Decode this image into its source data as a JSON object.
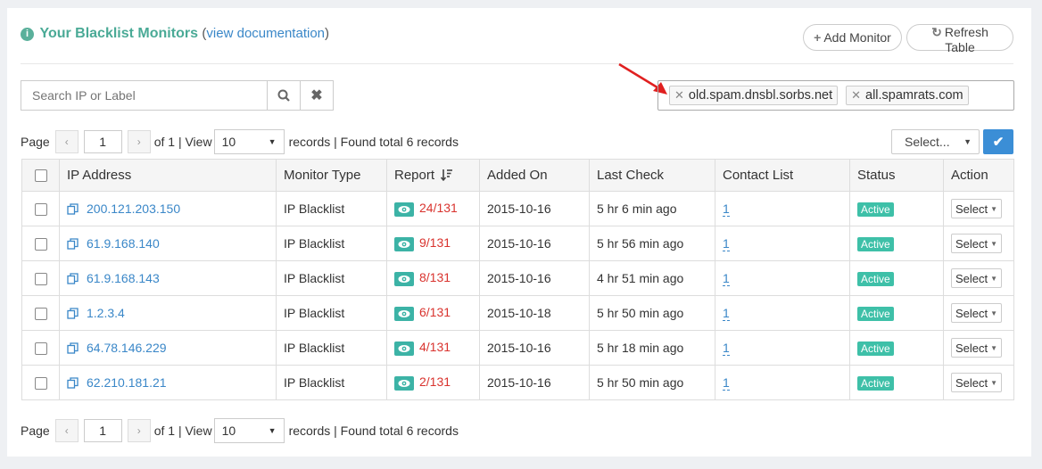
{
  "header": {
    "info_icon": "info-circle-icon",
    "title": "Your Blacklist Monitors",
    "doc_open": "(",
    "doc_link": "view documentation",
    "doc_close": ")"
  },
  "toolbar": {
    "add_label": "Add Monitor",
    "refresh_label": "Refresh Table"
  },
  "search": {
    "placeholder": "Search IP or Label",
    "search_icon": "search-icon",
    "clear_icon": "times-icon"
  },
  "filter_tags": [
    {
      "label": "old.spam.dnsbl.sorbs.net"
    },
    {
      "label": "all.spamrats.com"
    }
  ],
  "pager": {
    "page_label": "Page",
    "page_value": "1",
    "of_text": "of 1 | View",
    "per_page": "10",
    "records_text": "records | Found total 6 records"
  },
  "bulk": {
    "select_label": "Select...",
    "apply_icon": "check-icon"
  },
  "table": {
    "headers": {
      "ip": "IP Address",
      "type": "Monitor Type",
      "report": "Report",
      "added": "Added On",
      "last": "Last Check",
      "contact": "Contact List",
      "status": "Status",
      "action": "Action"
    },
    "rows": [
      {
        "ip": "200.121.203.150",
        "type": "IP Blacklist",
        "report": "24/131",
        "added": "2015-10-16",
        "last": "5 hr 6 min ago",
        "contact": "1",
        "status": "Active",
        "action": "Select"
      },
      {
        "ip": "61.9.168.140",
        "type": "IP Blacklist",
        "report": "9/131",
        "added": "2015-10-16",
        "last": "5 hr 56 min ago",
        "contact": "1",
        "status": "Active",
        "action": "Select"
      },
      {
        "ip": "61.9.168.143",
        "type": "IP Blacklist",
        "report": "8/131",
        "added": "2015-10-16",
        "last": "4 hr 51 min ago",
        "contact": "1",
        "status": "Active",
        "action": "Select"
      },
      {
        "ip": "1.2.3.4",
        "type": "IP Blacklist",
        "report": "6/131",
        "added": "2015-10-18",
        "last": "5 hr 50 min ago",
        "contact": "1",
        "status": "Active",
        "action": "Select"
      },
      {
        "ip": "64.78.146.229",
        "type": "IP Blacklist",
        "report": "4/131",
        "added": "2015-10-16",
        "last": "5 hr 18 min ago",
        "contact": "1",
        "status": "Active",
        "action": "Select"
      },
      {
        "ip": "62.210.181.21",
        "type": "IP Blacklist",
        "report": "2/131",
        "added": "2015-10-16",
        "last": "5 hr 50 min ago",
        "contact": "1",
        "status": "Active",
        "action": "Select"
      }
    ]
  },
  "colors": {
    "accent": "#4aaa96",
    "link": "#3a87c8",
    "report_red": "#d9332e",
    "status_badge": "#3ec0a8",
    "primary_button": "#3b8ed6",
    "annotation_arrow": "#e02020"
  }
}
